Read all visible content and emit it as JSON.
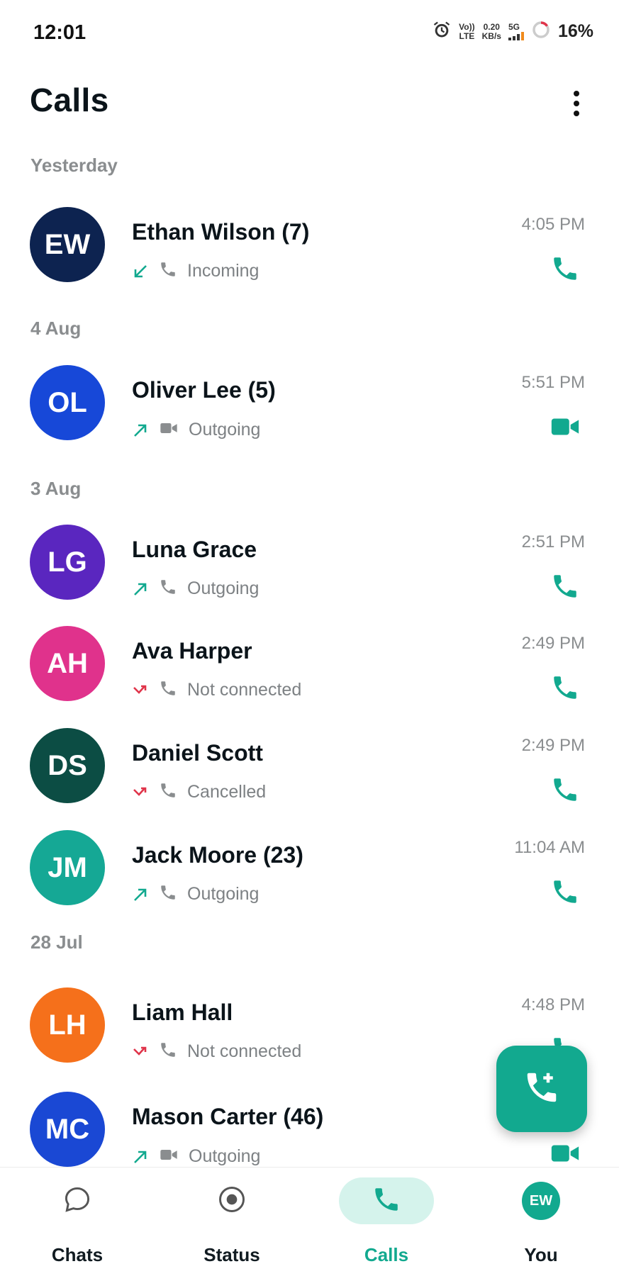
{
  "status_bar": {
    "time": "12:01",
    "volte_top": "Vo))",
    "volte_bottom": "LTE",
    "speed_top": "0.20",
    "speed_bottom": "KB/s",
    "network": "5G",
    "battery": "16%",
    "battery_level": 0.16
  },
  "header": {
    "title": "Calls"
  },
  "sections": [
    {
      "label": "Yesterday"
    },
    {
      "label": "4 Aug"
    },
    {
      "label": "3 Aug"
    },
    {
      "label": "28 Jul"
    }
  ],
  "calls": [
    {
      "initials": "EW",
      "name": "Ethan Wilson  (7)",
      "status": "Incoming",
      "time": "4:05 PM",
      "direction": "incoming",
      "type": "voice",
      "avatar_color": "#0d2350"
    },
    {
      "initials": "OL",
      "name": "Oliver Lee  (5)",
      "status": "Outgoing",
      "time": "5:51 PM",
      "direction": "outgoing",
      "type": "video",
      "avatar_color": "#1748d8"
    },
    {
      "initials": "LG",
      "name": "Luna Grace",
      "status": "Outgoing",
      "time": "2:51 PM",
      "direction": "outgoing",
      "type": "voice",
      "avatar_color": "#5a26bf"
    },
    {
      "initials": "AH",
      "name": "Ava Harper",
      "status": "Not connected",
      "time": "2:49 PM",
      "direction": "missed",
      "type": "voice",
      "avatar_color": "#e0328c"
    },
    {
      "initials": "DS",
      "name": "Daniel Scott",
      "status": "Cancelled",
      "time": "2:49 PM",
      "direction": "missed",
      "type": "voice",
      "avatar_color": "#0c4d44"
    },
    {
      "initials": "JM",
      "name": "Jack Moore  (23)",
      "status": "Outgoing",
      "time": "11:04 AM",
      "direction": "outgoing",
      "type": "voice",
      "avatar_color": "#15a895"
    },
    {
      "initials": "LH",
      "name": "Liam Hall",
      "status": "Not connected",
      "time": "4:48 PM",
      "direction": "missed",
      "type": "voice",
      "avatar_color": "#f5701b"
    },
    {
      "initials": "MC",
      "name": "Mason Carter  (46)",
      "status": "Outgoing",
      "time": "",
      "direction": "outgoing",
      "type": "video",
      "avatar_color": "#1a48d4"
    }
  ],
  "fab": {
    "icon": "add-call-icon"
  },
  "bottom_nav": {
    "items": [
      {
        "label": "Chats",
        "icon": "chat-bubble-icon",
        "active": false
      },
      {
        "label": "Status",
        "icon": "status-ring-icon",
        "active": false
      },
      {
        "label": "Calls",
        "icon": "phone-icon",
        "active": true
      },
      {
        "label": "You",
        "icon": "profile-avatar",
        "active": false
      }
    ],
    "profile_initials": "EW"
  },
  "colors": {
    "accent": "#12a98f",
    "incoming_arrow": "#12a98f",
    "outgoing_arrow": "#12a98f",
    "missed_arrow": "#e0344a",
    "muted_text": "#8a8d8f"
  }
}
